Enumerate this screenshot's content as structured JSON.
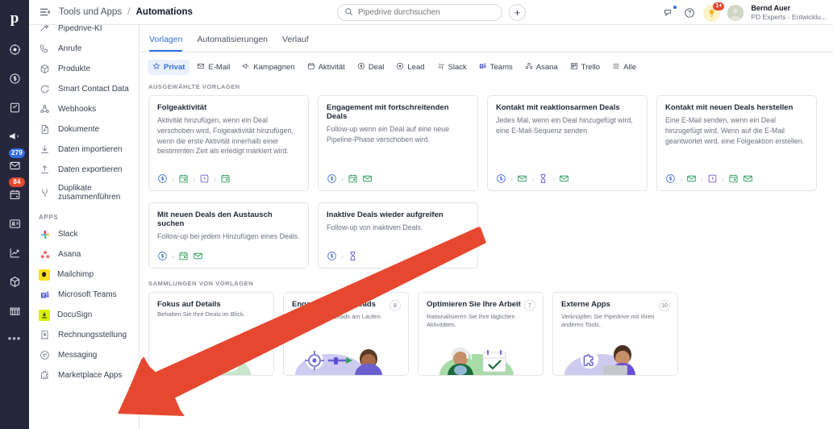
{
  "app": {
    "name": "Pipedrive",
    "logo_letter": "p"
  },
  "topbar": {
    "menu_icon": "hamburger-icon",
    "breadcrumb_parent": "Tools und Apps",
    "breadcrumb_sep": "/",
    "breadcrumb_current": "Automations",
    "search_placeholder": "Pipedrive durchsuchen",
    "search_value": "",
    "add_label": "+",
    "user": {
      "name": "Bernd Auer",
      "org": "PD Experts - Entwicklu...",
      "notifications_badge": "1+"
    }
  },
  "rail": {
    "items": [
      {
        "name": "leads-icon",
        "badge": ""
      },
      {
        "name": "deals-icon",
        "badge": ""
      },
      {
        "name": "activities-icon",
        "badge": ""
      },
      {
        "name": "campaigns-icon",
        "badge": ""
      },
      {
        "name": "mail-icon",
        "badge": "279",
        "badge_color": "#2f6ee4"
      },
      {
        "name": "calendar-icon",
        "badge": "84",
        "badge_color": "#e5482f"
      },
      {
        "name": "contacts-icon",
        "badge": ""
      },
      {
        "name": "insights-icon",
        "badge": ""
      },
      {
        "name": "products-icon",
        "badge": ""
      },
      {
        "name": "marketplace-icon",
        "badge": ""
      }
    ],
    "more": "•••"
  },
  "sidebar": {
    "items": [
      {
        "label": "Pipedrive-KI",
        "icon": "ai-sparkle-icon"
      },
      {
        "label": "Anrufe",
        "icon": "phone-icon"
      },
      {
        "label": "Produkte",
        "icon": "box-icon"
      },
      {
        "label": "Smart Contact Data",
        "icon": "refresh-icon"
      },
      {
        "label": "Webhooks",
        "icon": "webhook-icon"
      },
      {
        "label": "Dokumente",
        "icon": "document-icon"
      },
      {
        "label": "Daten importieren",
        "icon": "import-icon"
      },
      {
        "label": "Daten exportieren",
        "icon": "export-icon"
      },
      {
        "label": "Duplikate zusammenführen",
        "icon": "merge-icon"
      }
    ],
    "apps_section": "APPS",
    "apps": [
      {
        "label": "Slack",
        "icon": "slack-icon",
        "color": "#e01e5a"
      },
      {
        "label": "Asana",
        "icon": "asana-icon",
        "color": "#f06a6a"
      },
      {
        "label": "Mailchimp",
        "icon": "mailchimp-icon",
        "color": "#ffe01b"
      },
      {
        "label": "Microsoft Teams",
        "icon": "teams-icon",
        "color": "#5059c9"
      },
      {
        "label": "DocuSign",
        "icon": "docusign-icon",
        "color": "#d7f205"
      },
      {
        "label": "Rechnungsstellung",
        "icon": "invoice-icon",
        "color": "#6b7280"
      },
      {
        "label": "Messaging",
        "icon": "messaging-icon",
        "color": "#6b7280"
      },
      {
        "label": "Marketplace Apps",
        "icon": "marketplace-apps-icon",
        "color": "#6b7280"
      }
    ]
  },
  "main": {
    "tabs": [
      {
        "label": "Vorlagen",
        "active": true
      },
      {
        "label": "Automatisierungen",
        "active": false
      },
      {
        "label": "Verlauf",
        "active": false
      }
    ],
    "filters": [
      {
        "label": "Privat",
        "icon": "star-icon",
        "active": true
      },
      {
        "label": "E-Mail",
        "icon": "envelope-icon",
        "active": false
      },
      {
        "label": "Kampagnen",
        "icon": "megaphone-icon",
        "active": false
      },
      {
        "label": "Aktivität",
        "icon": "calendar-icon",
        "active": false
      },
      {
        "label": "Deal",
        "icon": "dollar-icon",
        "active": false
      },
      {
        "label": "Lead",
        "icon": "target-icon",
        "active": false
      },
      {
        "label": "Slack",
        "icon": "slack-icon",
        "active": false
      },
      {
        "label": "Teams",
        "icon": "teams-icon",
        "active": false
      },
      {
        "label": "Asana",
        "icon": "asana-icon",
        "active": false
      },
      {
        "label": "Trello",
        "icon": "trello-icon",
        "active": false
      },
      {
        "label": "Alle",
        "icon": "list-icon",
        "active": false
      }
    ],
    "selected_templates_label": "AUSGEWÄHLTE VORLAGEN",
    "templates_row1": [
      {
        "title": "Folgeaktivität",
        "desc": "Aktivität hinzufügen, wenn ein Deal verschoben wird, Folgeaktivität hinzufügen, wenn die erste Aktivität innerhalb einer bestimmten Zeit als erledigt markiert wird.",
        "flow": [
          "deal-icon",
          "calendar-icon",
          "clock-icon",
          "calendar-icon"
        ]
      },
      {
        "title": "Engagement mit fortschreitenden Deals",
        "desc": "Follow-up wenn ein Deal auf eine neue Pipeline-Phase verschoben wird.",
        "flow": [
          "deal-icon",
          "calendar-icon",
          "envelope-icon"
        ]
      },
      {
        "title": "Kontakt mit reaktionsarmen Deals",
        "desc": "Jedes Mal, wenn ein Deal hinzugefügt wird, eine E-Mail-Sequenz senden",
        "flow": [
          "deal-icon",
          "envelope-icon",
          "hourglass-icon",
          "envelope-icon"
        ]
      },
      {
        "title": "Kontakt mit neuen Deals herstellen",
        "desc": "Eine E-Mail senden, wenn ein Deal hinzugefügt wird. Wenn auf die E-Mail geantwortet wird, eine Folgeaktion erstellen.",
        "flow": [
          "deal-icon",
          "envelope-icon",
          "clock-icon",
          "calendar-icon",
          "envelope-icon"
        ]
      }
    ],
    "templates_row2": [
      {
        "title": "Mit neuen Deals den Austausch suchen",
        "desc": "Follow-up bei jedem Hinzufügen eines Deals.",
        "flow": [
          "deal-icon",
          "calendar-icon",
          "envelope-icon"
        ]
      },
      {
        "title": "Inaktive Deals wieder aufgreifen",
        "desc": "Follow-up von inaktiven Deals.",
        "flow": [
          "deal-icon",
          "hourglass-icon"
        ]
      }
    ],
    "collections_label": "SAMMLUNGEN VON VORLAGEN",
    "collections": [
      {
        "title": "Fokus auf Details",
        "desc": "Behalten Sie Ihre Deals im Blick.",
        "badge": "",
        "art": "deal-money-illustration"
      },
      {
        "title": "Engagement mit Leads",
        "desc": "Halten Sie Ihre Leads am Laufen.",
        "badge": "8",
        "art": "lead-target-illustration"
      },
      {
        "title": "Optimieren Sie Ihre Arbeit",
        "desc": "Rationalisieren Sie Ihre täglichen Aktivitäten.",
        "badge": "7",
        "art": "calendar-coffee-illustration"
      },
      {
        "title": "Externe Apps",
        "desc": "Verknüpfen Sie Pipedrive mit Ihren anderen Tools.",
        "badge": "10",
        "art": "puzzle-laptop-illustration"
      }
    ]
  },
  "annotation": {
    "arrow_color": "#e5482f",
    "name": "red-pointer-arrow"
  }
}
